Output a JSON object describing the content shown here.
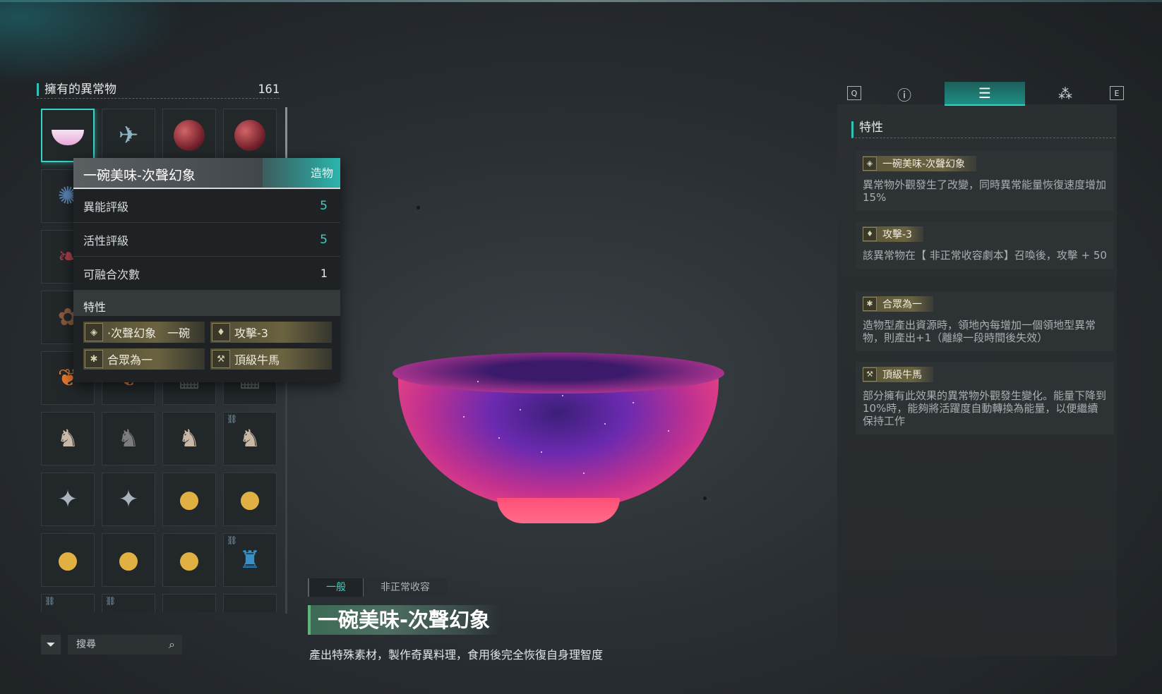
{
  "inventory": {
    "title": "擁有的異常物",
    "count": "161",
    "search_placeholder": "搜尋"
  },
  "tooltip": {
    "name": "一碗美味-次聲幻象",
    "type": "造物",
    "rows": [
      {
        "label": "異能評級",
        "value": "5"
      },
      {
        "label": "活性評級",
        "value": "5"
      },
      {
        "label": "可融合次數",
        "value": "1"
      }
    ],
    "traits_label": "特性",
    "traits": [
      "·次聲幻象　一碗",
      "攻擊-3",
      "合眾為一",
      "頂級牛馬"
    ]
  },
  "item": {
    "category_tabs": [
      "一般",
      "非正常收容"
    ],
    "title": "一碗美味-次聲幻象",
    "description": "產出特殊素材，製作奇異料理，食用後完全恢復自身理智度"
  },
  "right_panel": {
    "key_left": "Q",
    "key_right": "E",
    "section_title": "特性",
    "traits": [
      {
        "name": "一碗美味-次聲幻象",
        "desc": "異常物外觀發生了改變，同時異常能量恢復速度增加15%",
        "icon": "diamond-icon"
      },
      {
        "name": "攻擊-3",
        "desc": "該異常物在【 非正常收容劇本】召喚後，攻擊 + 50",
        "icon": "crystal-icon"
      },
      {
        "name": "合眾為一",
        "desc": "造物型產出資源時，領地內每增加一個領地型異常物，則產出+1（離線一段時間後失效）",
        "icon": "snowflake-icon"
      },
      {
        "name": "頂級牛馬",
        "desc": "部分擁有此效果的異常物外觀發生變化。能量下降到10%時，能夠將活躍度自動轉換為能量，以便繼續保持工作",
        "icon": "worker-icon"
      }
    ]
  },
  "colors": {
    "accent": "#33d6c3",
    "trait_gold": "#6b6340",
    "bowl_pink": "#ff4f7d"
  }
}
